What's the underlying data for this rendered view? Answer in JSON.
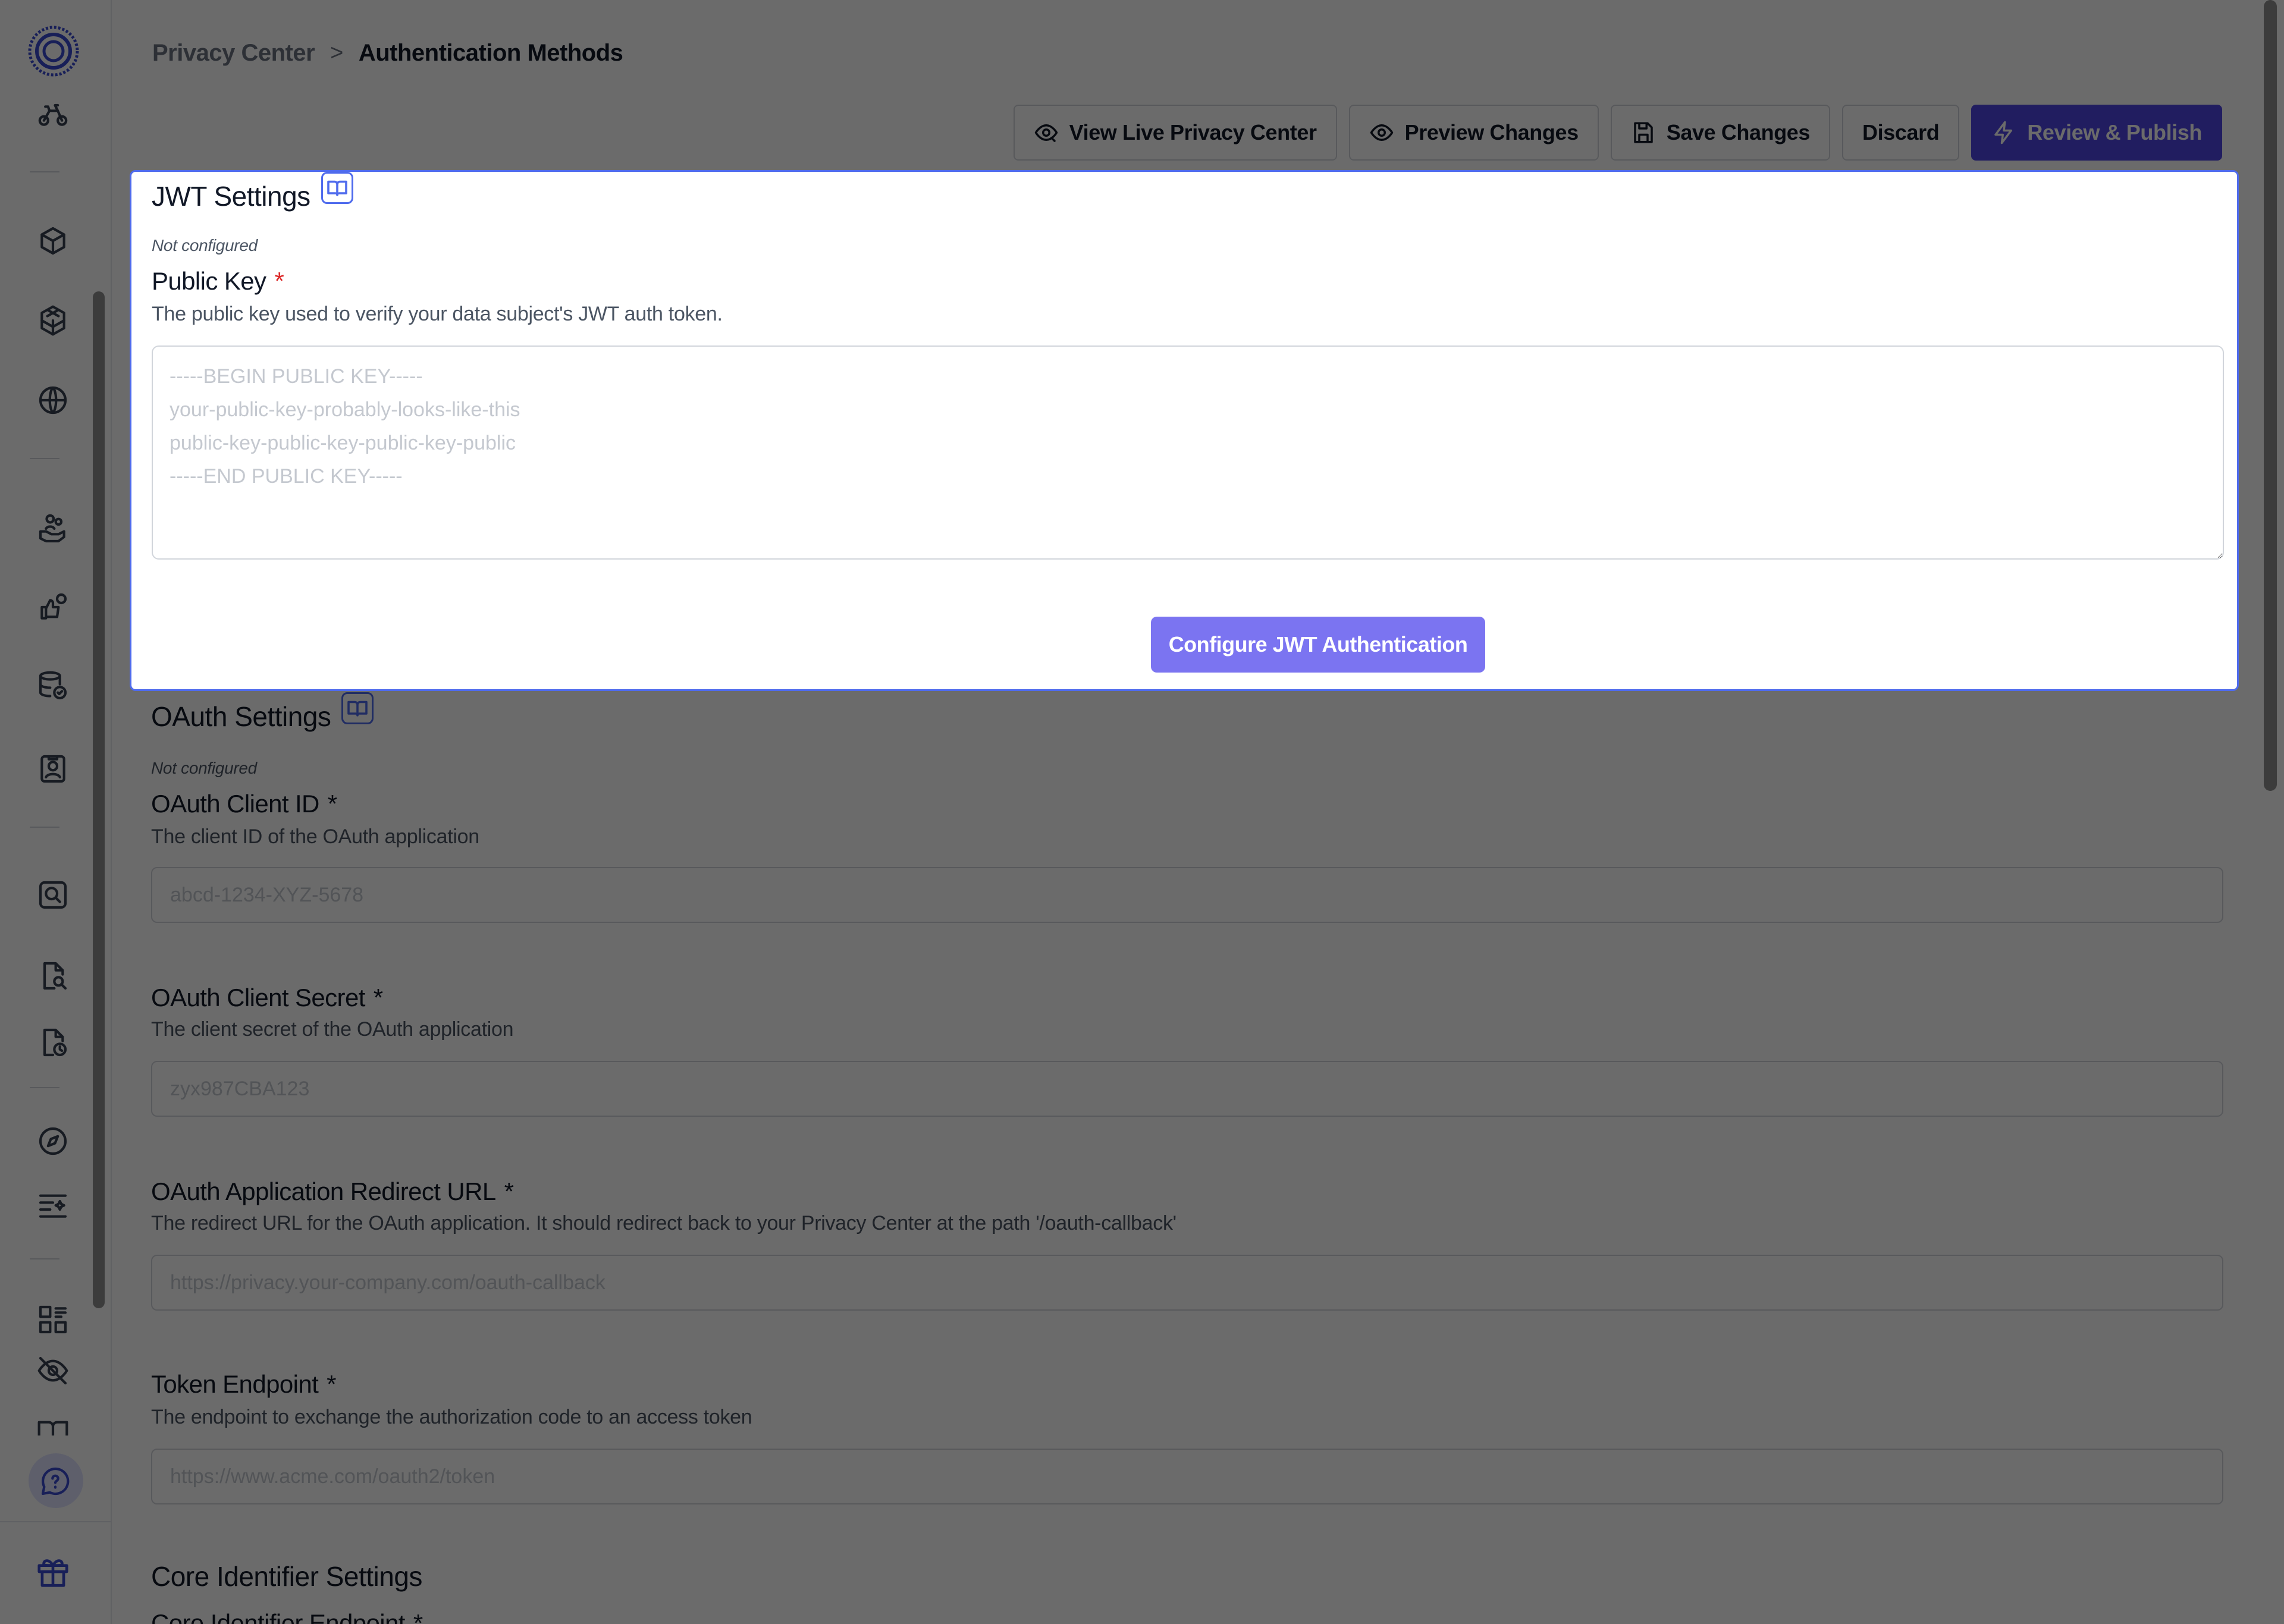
{
  "breadcrumb": {
    "parent": "Privacy Center",
    "separator": ">",
    "current": "Authentication Methods"
  },
  "toolbar": {
    "view_live": "View Live Privacy Center",
    "preview": "Preview Changes",
    "save": "Save Changes",
    "discard": "Discard",
    "publish": "Review & Publish"
  },
  "colors": {
    "accent": "#4f46e5",
    "accent_light": "#7b74f1",
    "focus_border": "#4f6bed",
    "required": "#dc2626"
  },
  "sidebar": {
    "icons": [
      "bike-icon",
      "box-icon",
      "cube-stack-icon",
      "globe-icon",
      "hand-people-icon",
      "thumbs-link-icon",
      "database-check-icon",
      "id-badge-icon",
      "search-box-icon",
      "file-search-icon",
      "file-clock-icon",
      "compass-icon",
      "list-sparkle-icon",
      "layout-grid-icon",
      "eye-off-icon",
      "book-open-icon",
      "help-bubble-icon",
      "gift-icon"
    ]
  },
  "jwt": {
    "title": "JWT Settings",
    "status": "Not configured",
    "public_key": {
      "label": "Public Key",
      "required": "*",
      "help": "The public key used to verify your data subject's JWT auth token.",
      "placeholder": "-----BEGIN PUBLIC KEY-----\nyour-public-key-probably-looks-like-this\npublic-key-public-key-public-key-public\n-----END PUBLIC KEY-----"
    },
    "button": "Configure JWT Authentication"
  },
  "oauth": {
    "title": "OAuth Settings",
    "status": "Not configured",
    "client_id": {
      "label": "OAuth Client ID",
      "required": "*",
      "help": "The client ID of the OAuth application",
      "placeholder": "abcd-1234-XYZ-5678"
    },
    "client_secret": {
      "label": "OAuth Client Secret",
      "required": "*",
      "help": "The client secret of the OAuth application",
      "placeholder": "zyx987CBA123"
    },
    "redirect_url": {
      "label": "OAuth Application Redirect URL",
      "required": "*",
      "help": "The redirect URL for the OAuth application. It should redirect back to your Privacy Center at the path '/oauth-callback'",
      "placeholder": "https://privacy.your-company.com/oauth-callback"
    },
    "token_endpoint": {
      "label": "Token Endpoint",
      "required": "*",
      "help": "The endpoint to exchange the authorization code to an access token",
      "placeholder": "https://www.acme.com/oauth2/token"
    }
  },
  "core": {
    "title": "Core Identifier Settings",
    "endpoint_label": "Core Identifier Endpoint",
    "required": "*"
  }
}
